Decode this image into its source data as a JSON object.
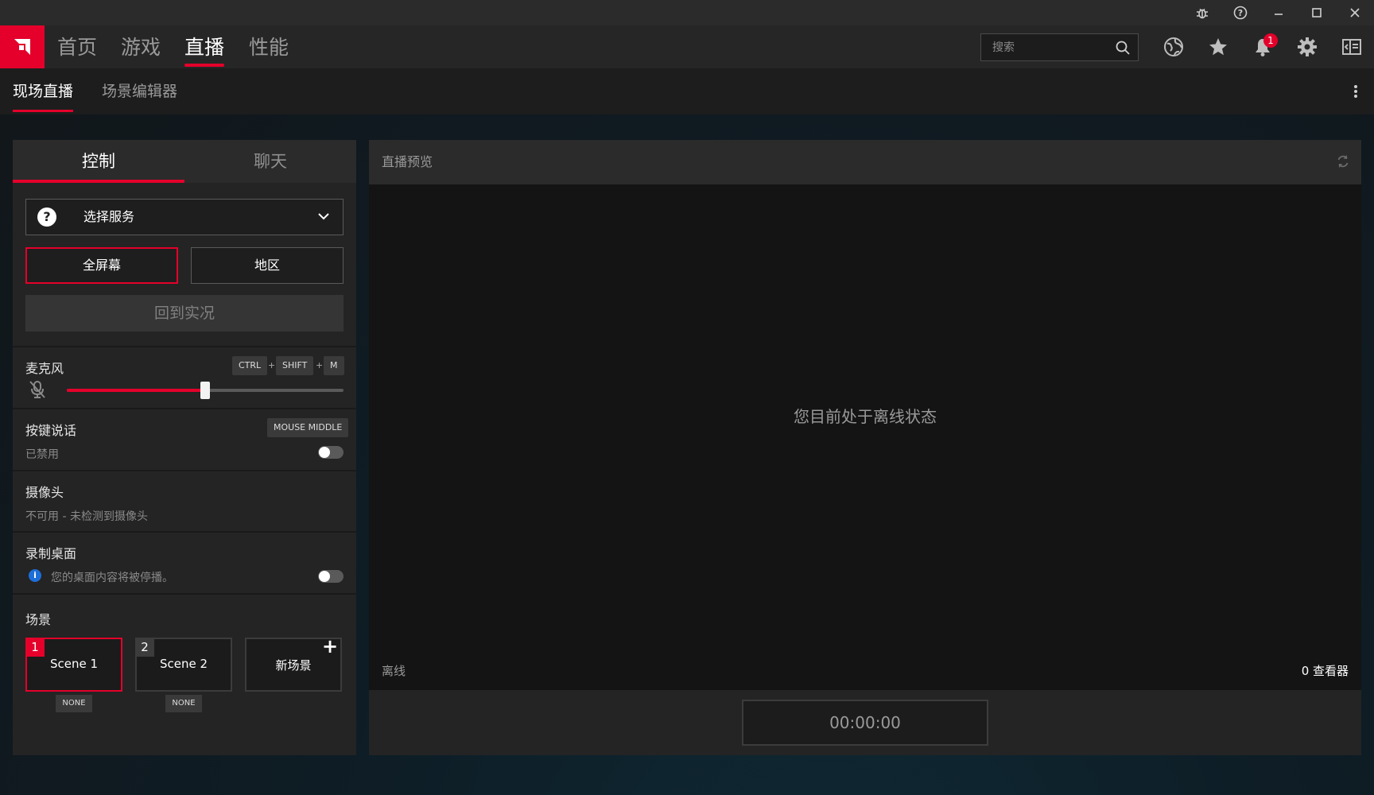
{
  "nav": {
    "tabs": [
      {
        "label": "首页"
      },
      {
        "label": "游戏"
      },
      {
        "label": "直播"
      },
      {
        "label": "性能"
      }
    ],
    "search_placeholder": "搜索",
    "notification_count": "1"
  },
  "subnav": {
    "tabs": [
      {
        "label": "现场直播"
      },
      {
        "label": "场景编辑器"
      }
    ]
  },
  "left": {
    "tabs": [
      {
        "label": "控制"
      },
      {
        "label": "聊天"
      }
    ],
    "service_label": "选择服务",
    "fullscreen_label": "全屏幕",
    "region_label": "地区",
    "back_live_label": "回到实况",
    "mic": {
      "title": "麦克风",
      "keys": [
        "CTRL",
        "SHIFT",
        "M"
      ],
      "level": 0.5
    },
    "ptt": {
      "title": "按键说话",
      "key": "MOUSE MIDDLE",
      "status": "已禁用"
    },
    "camera": {
      "title": "摄像头",
      "status": "不可用 - 未检测到摄像头"
    },
    "desktop": {
      "title": "录制桌面",
      "note": "您的桌面内容将被停播。"
    },
    "scenes": {
      "title": "场景",
      "items": [
        {
          "num": "1",
          "name": "Scene 1",
          "tag": "NONE"
        },
        {
          "num": "2",
          "name": "Scene 2",
          "tag": "NONE"
        }
      ],
      "new_label": "新场景"
    }
  },
  "right": {
    "title": "直播预览",
    "offline_message": "您目前处于离线状态",
    "status": "离线",
    "viewers": "0 查看器",
    "timer": "00:00:00"
  },
  "colors": {
    "accent": "#e4002b",
    "info": "#1e6ed8"
  }
}
